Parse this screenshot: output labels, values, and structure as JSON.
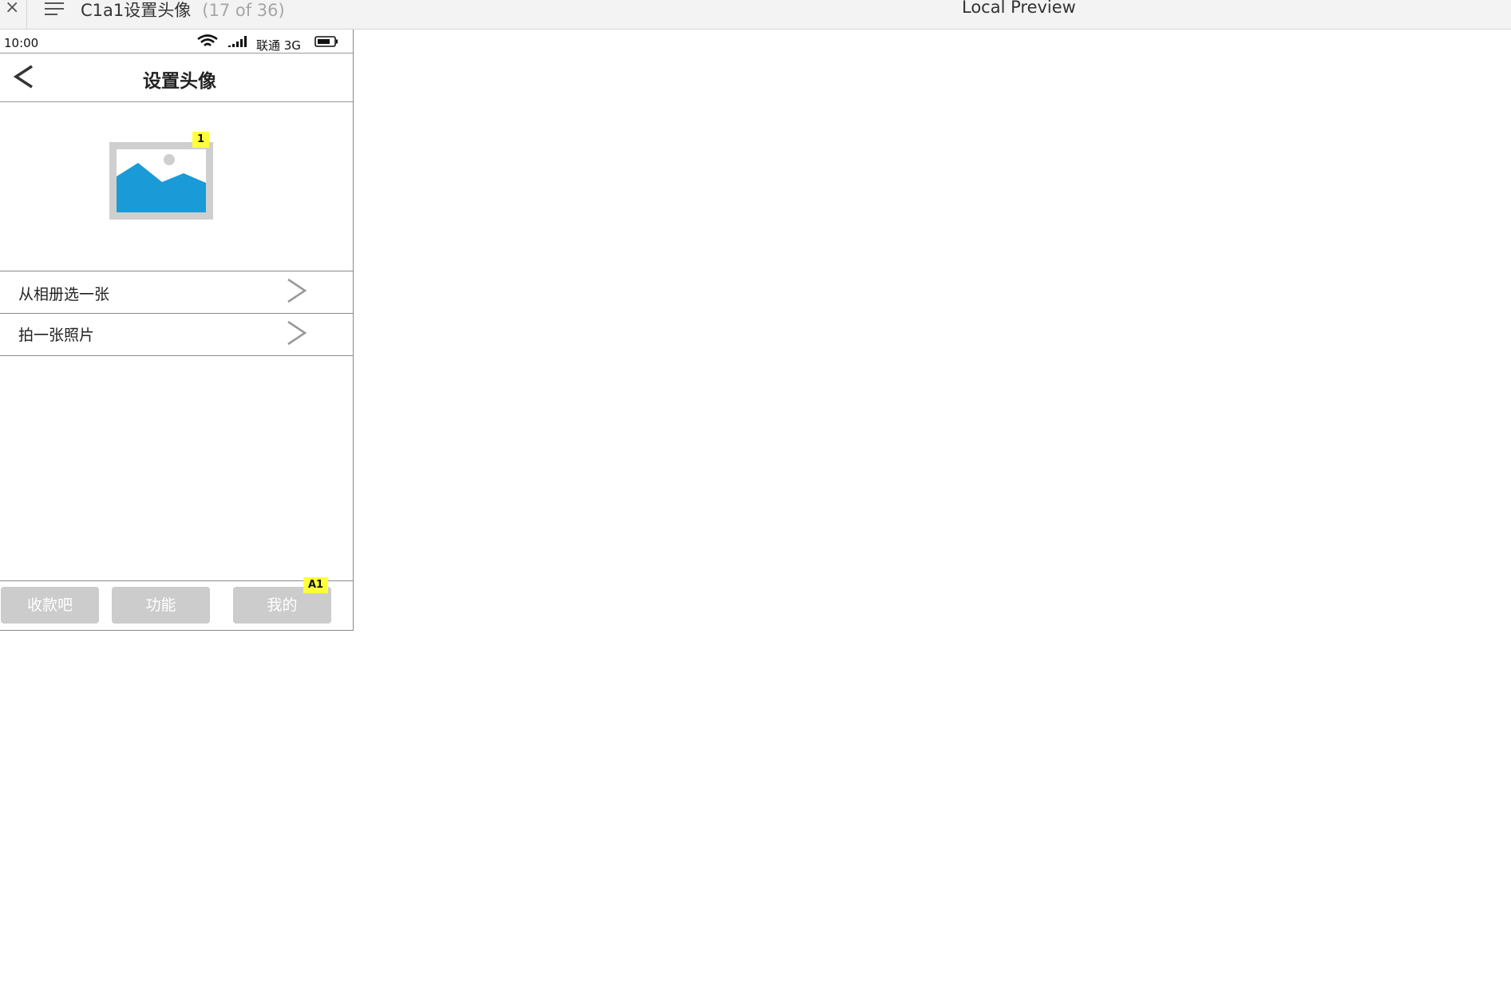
{
  "window": {
    "page_title": "C1a1设置头像",
    "page_count": "(17 of 36)",
    "preview_label": "Local Preview",
    "close_glyph": "×"
  },
  "statusbar": {
    "time": "10:00",
    "carrier": "联通 3G",
    "icons": [
      "wifi-icon",
      "signal-icon",
      "battery-icon"
    ]
  },
  "navbar": {
    "title": "设置头像",
    "back_icon": "chevron-left-icon"
  },
  "avatar": {
    "icon": "image-placeholder-icon",
    "badge": "1",
    "colors": {
      "frame": "#cfcfcf",
      "mountain": "#1a9ad6",
      "sun": "#cfcfcf"
    }
  },
  "options": [
    {
      "label": "从相册选一张",
      "icon": "chevron-right-icon"
    },
    {
      "label": "拍一张照片",
      "icon": "chevron-right-icon"
    }
  ],
  "tabbar": {
    "tabs": [
      {
        "label": "收款吧"
      },
      {
        "label": "功能"
      },
      {
        "label": "我的"
      }
    ],
    "badge": "A1",
    "colors": {
      "tab_bg": "#cccccc",
      "tab_text": "#ffffff",
      "badge_bg": "#ffff3a"
    }
  }
}
